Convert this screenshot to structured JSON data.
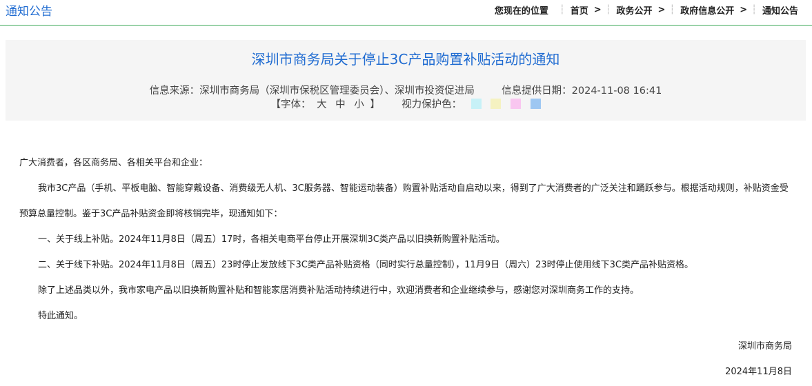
{
  "section_title": "通知公告",
  "breadcrumb": {
    "lead": "您现在的位置",
    "items": [
      "首页",
      "政务公开",
      "政府信息公开",
      "通知公告"
    ],
    "arrow": ">"
  },
  "article": {
    "title": "深圳市商务局关于停止3C产品购置补贴活动的通知",
    "source_label": "信息来源：",
    "source": "深圳市商务局（深圳市保税区管理委员会）、深圳市投资促进局",
    "date_label": "信息提供日期：",
    "date": "2024-11-08 16:41",
    "font_label": "【字体：",
    "font_sizes": [
      "大",
      "中",
      "小"
    ],
    "font_close": "】",
    "eye_label": "视力保护色：",
    "swatch_colors": [
      "#c7f1f7",
      "#f5f2c1",
      "#f9c6f0",
      "#9ec7f2"
    ]
  },
  "body": {
    "greeting": "广大消费者，各区商务局、各相关平台和企业：",
    "p1": "我市3C产品（手机、平板电脑、智能穿戴设备、消费级无人机、3C服务器、智能运动装备）购置补贴活动自启动以来，得到了广大消费者的广泛关注和踊跃参与。根据活动规则，补贴资金受预算总量控制。鉴于3C产品补贴资金即将核销完毕，现通知如下：",
    "p2": "一、关于线上补贴。2024年11月8日（周五）17时，各相关电商平台停止开展深圳3C类产品以旧换新购置补贴活动。",
    "p3": "二、关于线下补贴。2024年11月8日（周五）23时停止发放线下3C类产品补贴资格（同时实行总量控制），11月9日（周六）23时停止使用线下3C类产品补贴资格。",
    "p4": "除了上述品类以外，我市家电产品以旧换新购置补贴和智能家居消费补贴活动持续进行中，欢迎消费者和企业继续参与，感谢您对深圳商务工作的支持。",
    "p5": "特此通知。",
    "signer": "深圳市商务局",
    "sign_date": "2024年11月8日"
  }
}
